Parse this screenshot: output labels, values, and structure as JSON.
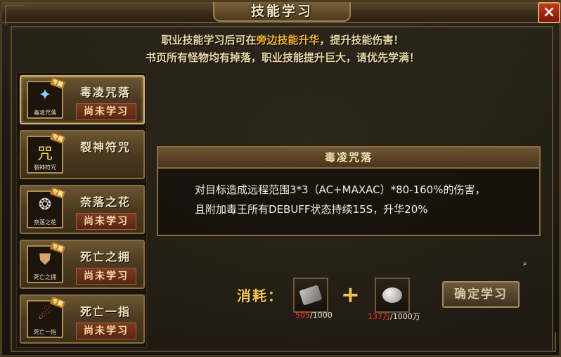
{
  "window": {
    "title": "技能学习",
    "close_label": "×"
  },
  "notice": {
    "line1_pre": "职业技能学习后可在",
    "line1_highlight": "旁边技能升华",
    "line1_post": "，提升技能伤害！",
    "line2": "书页所有怪物均有掉落，职业技能提升巨大，请优先学满！"
  },
  "skills": [
    {
      "name": "毒凌咒落",
      "icon_caption": "毒凌咒落",
      "tag": "专属",
      "status": "尚未学习",
      "active": true
    },
    {
      "name": "裂神符咒",
      "icon_caption": "裂神符咒",
      "tag": "专属",
      "status": "",
      "active": false
    },
    {
      "name": "奈落之花",
      "icon_caption": "奈落之花",
      "tag": "专属",
      "status": "尚未学习",
      "active": false
    },
    {
      "name": "死亡之拥",
      "icon_caption": "死亡之拥",
      "tag": "专属",
      "status": "尚未学习",
      "active": false
    },
    {
      "name": "死亡一指",
      "icon_caption": "死亡一指",
      "tag": "专属",
      "status": "尚未学习",
      "active": false
    }
  ],
  "detail": {
    "title": "毒凌咒落",
    "line1": "对目标造成远程范围3*3（AC+MAXAC）*80-160%的伤害，",
    "line2": "且附加毒王所有DEBUFF状态持续15S，升华20%"
  },
  "cost": {
    "label": "消耗：",
    "item1": {
      "have": "505",
      "need": "/1000",
      "icon": "book-page-icon"
    },
    "item2": {
      "have": "137万",
      "need": "/1000万",
      "icon": "silver-ingot-icon"
    }
  },
  "confirm_label": "确定学习",
  "colors": {
    "accent": "#f7b52c",
    "warning": "#ff3a2a"
  }
}
